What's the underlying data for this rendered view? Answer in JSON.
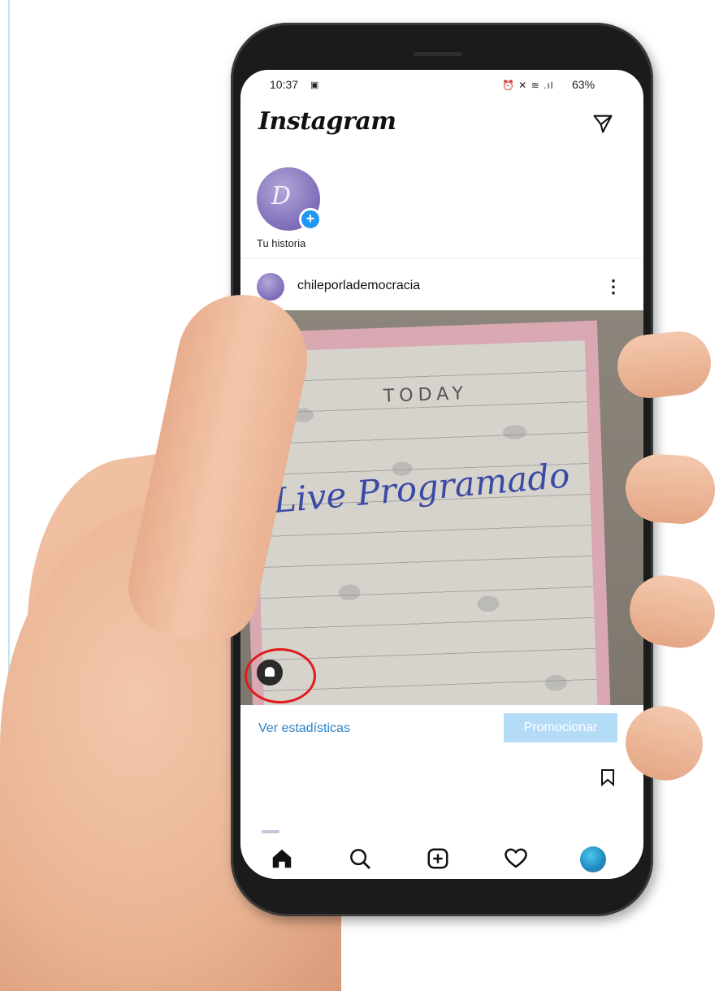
{
  "status_bar": {
    "time": "10:37",
    "image_glyph": "▣",
    "icons_text": "⏰ ✕ ≋ .ıl",
    "battery": "63%"
  },
  "app": {
    "logo": "Instagram",
    "send_icon": "send-icon"
  },
  "story": {
    "label": "Tu historia",
    "avatar_text": "D"
  },
  "post": {
    "username": "chileporlademocracia",
    "more_glyph": "⋮",
    "image": {
      "heading": "TODAY",
      "handwriting": "Live Programado"
    }
  },
  "actions": {
    "stats_link": "Ver estadísticas",
    "promote_button": "Promocionar"
  },
  "bottom_nav": [
    "home-icon",
    "search-icon",
    "add-post-icon",
    "heart-icon",
    "profile-avatar"
  ],
  "colors": {
    "link": "#2c82c9",
    "promote": "#b5dcf7",
    "highlight": "#e01b1b",
    "story_plus": "#2196f3"
  }
}
